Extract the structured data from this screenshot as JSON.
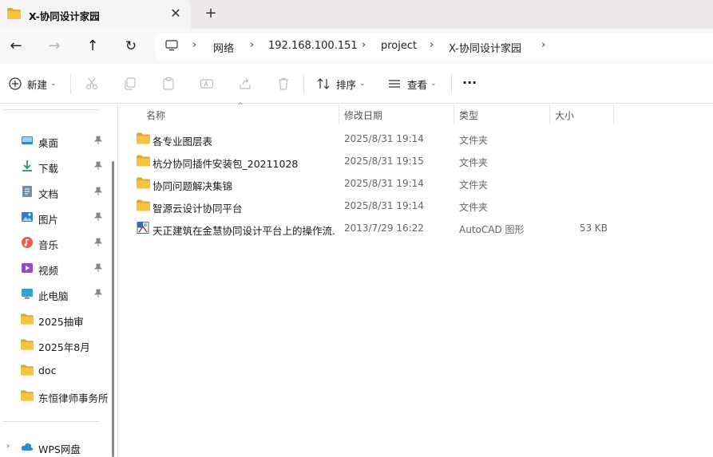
{
  "tab": {
    "title": "X-协同设计家园",
    "close_glyph": "✕",
    "new_tab_glyph": "+"
  },
  "nav": {
    "back": "←",
    "forward": "→",
    "up": "↑",
    "refresh": "↻"
  },
  "breadcrumb": {
    "separator": "›",
    "items": [
      "网络",
      "192.168.100.151",
      "project",
      "X-协同设计家园"
    ]
  },
  "toolbar": {
    "new_label": "新建",
    "sort_label": "排序",
    "view_label": "查看",
    "more_glyph": "···",
    "chevron": "⌄"
  },
  "sidebar": {
    "items": [
      {
        "label": "桌面",
        "icon": "desktop-icon",
        "pinned": true
      },
      {
        "label": "下载",
        "icon": "download-icon",
        "pinned": true
      },
      {
        "label": "文档",
        "icon": "documents-icon",
        "pinned": true
      },
      {
        "label": "图片",
        "icon": "pictures-icon",
        "pinned": true
      },
      {
        "label": "音乐",
        "icon": "music-icon",
        "pinned": true
      },
      {
        "label": "视频",
        "icon": "videos-icon",
        "pinned": true
      },
      {
        "label": "此电脑",
        "icon": "this-pc-icon",
        "pinned": true
      },
      {
        "label": "2025抽审",
        "icon": "folder-icon",
        "pinned": false
      },
      {
        "label": "2025年8月",
        "icon": "folder-icon",
        "pinned": false
      },
      {
        "label": "doc",
        "icon": "folder-icon",
        "pinned": false
      },
      {
        "label": "东恒律师事务所",
        "icon": "folder-icon",
        "pinned": false
      }
    ],
    "cloud": {
      "label": "WPS网盘",
      "icon": "cloud-icon",
      "expander": "›"
    }
  },
  "columns": {
    "name": "名称",
    "date": "修改日期",
    "type": "类型",
    "size": "大小",
    "sort_glyph": "^"
  },
  "files": [
    {
      "name": "各专业图层表",
      "date": "2025/8/31 19:14",
      "type": "文件夹",
      "size": "",
      "icon": "folder-icon"
    },
    {
      "name": "杭分协同插件安装包_20211028",
      "date": "2025/8/31 19:15",
      "type": "文件夹",
      "size": "",
      "icon": "folder-icon"
    },
    {
      "name": "协同问题解决集锦",
      "date": "2025/8/31 19:14",
      "type": "文件夹",
      "size": "",
      "icon": "folder-icon"
    },
    {
      "name": "智源云设计协同平台",
      "date": "2025/8/31 19:14",
      "type": "文件夹",
      "size": "",
      "icon": "folder-icon"
    },
    {
      "name": "天正建筑在金慧协同设计平台上的操作流...",
      "date": "2013/7/29 16:22",
      "type": "AutoCAD 图形",
      "size": "53 KB",
      "icon": "autocad-file-icon"
    }
  ],
  "colors": {
    "folder": "#f5c342",
    "folder_dark": "#e0a82e",
    "accent": "#0067c0"
  }
}
